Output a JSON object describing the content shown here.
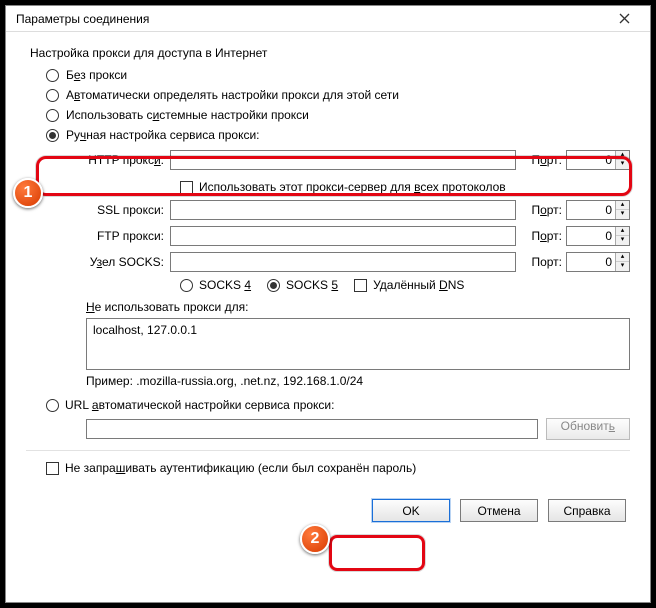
{
  "window": {
    "title": "Параметры соединения"
  },
  "section": {
    "header": "Настройка прокси для доступа в Интернет"
  },
  "radios": {
    "none_pre": "Б",
    "none_u": "е",
    "none_post": "з прокси",
    "auto_pre": "А",
    "auto_u": "в",
    "auto_post": "томатически определять настройки прокси для этой сети",
    "sys_pre": "Использовать с",
    "sys_u": "и",
    "sys_post": "стемные настройки прокси",
    "manual_pre": "Ру",
    "manual_u": "ч",
    "manual_post": "ная настройка сервиса прокси:",
    "url_pre": "URL ",
    "url_u": "а",
    "url_post": "втоматической настройки сервиса прокси:"
  },
  "proxy": {
    "http_label_pre": "HTTP прокс",
    "http_label_u": "и",
    "http_label_post": ":",
    "http_port_pre": "П",
    "http_port_u": "о",
    "http_port_post": "рт:",
    "ssl_label": "SSL прокси:",
    "ssl_port_pre": "П",
    "ssl_port_u": "о",
    "ssl_port_post": "рт:",
    "ftp_label": "FTP прокси:",
    "ftp_port_pre": "П",
    "ftp_port_u": "о",
    "ftp_port_post": "рт:",
    "socks_pre": "У",
    "socks_u": "з",
    "socks_post": "ел SOCKS:",
    "socks_port": "Порт:",
    "port0": "0",
    "useforall_pre": "Использовать этот прокси-сервер для ",
    "useforall_u": "в",
    "useforall_post": "сех протоколов"
  },
  "socks": {
    "v4_pre": "SOCKS ",
    "v4_u": "4",
    "v5_pre": "SOCKS ",
    "v5_u": "5",
    "dns_pre": "Удалённый ",
    "dns_u": "D",
    "dns_post": "NS"
  },
  "noproxy": {
    "label_pre": "",
    "label_u": "Н",
    "label_post": "е использовать прокси для:",
    "value": "localhost, 127.0.0.1",
    "example": "Пример: .mozilla-russia.org, .net.nz, 192.168.1.0/24"
  },
  "update_pre": "Обновит",
  "update_u": "ь",
  "auth_pre": "Не запра",
  "auth_u": "ш",
  "auth_post": "ивать аутентификацию (если был сохранён пароль)",
  "buttons": {
    "ok": "OK",
    "cancel": "Отмена",
    "help": "Справка"
  },
  "badges": {
    "one": "1",
    "two": "2"
  }
}
